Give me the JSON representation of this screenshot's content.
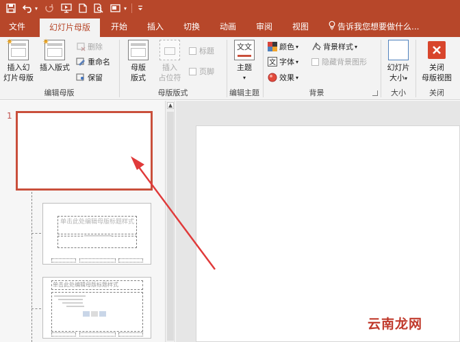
{
  "qat": {
    "icons": [
      "save-icon",
      "undo-icon",
      "redo-icon",
      "start-slideshow-icon",
      "new-file-icon",
      "print-preview-icon",
      "screenshot-icon",
      "customize-qat-icon"
    ]
  },
  "tabs": [
    {
      "label": "文件",
      "active": false
    },
    {
      "label": "幻灯片母版",
      "active": true
    },
    {
      "label": "开始",
      "active": false
    },
    {
      "label": "插入",
      "active": false
    },
    {
      "label": "切换",
      "active": false
    },
    {
      "label": "动画",
      "active": false
    },
    {
      "label": "审阅",
      "active": false
    },
    {
      "label": "视图",
      "active": false
    }
  ],
  "tell_me": "告诉我您想要做什么...",
  "ribbon": {
    "edit_master": {
      "label": "编辑母版",
      "insert_slide_master_l1": "插入幻",
      "insert_slide_master_l2": "灯片母版",
      "insert_layout": "插入版式",
      "delete": "删除",
      "rename": "重命名",
      "preserve": "保留"
    },
    "master_layout": {
      "label": "母版版式",
      "master_layout_l1": "母版",
      "master_layout_l2": "版式",
      "insert_placeholder_l1": "插入",
      "insert_placeholder_l2": "占位符",
      "title": "标题",
      "footer": "页脚"
    },
    "edit_theme": {
      "label": "编辑主题",
      "themes": "主题",
      "theme_icon_text": "文文"
    },
    "background": {
      "label": "背景",
      "colors": "颜色",
      "fonts": "字体",
      "effects": "效果",
      "background_styles": "背景样式",
      "hide_background_graphics": "隐藏背景图形"
    },
    "size": {
      "label": "大小",
      "slide_size_l1": "幻灯片",
      "slide_size_l2": "大小"
    },
    "close": {
      "label": "关闭",
      "close_master_view_l1": "关闭",
      "close_master_view_l2": "母版视图"
    }
  },
  "slides_panel": {
    "selected_number": "1",
    "thumb2_title": "单击此处编辑母版标题样式",
    "thumb3_title": "单击此处编辑母版标题样式"
  },
  "watermark": "云南龙网",
  "colors": {
    "accent": "#b7472a",
    "selection": "#c94f3b",
    "arrow": "#e03a3a"
  }
}
